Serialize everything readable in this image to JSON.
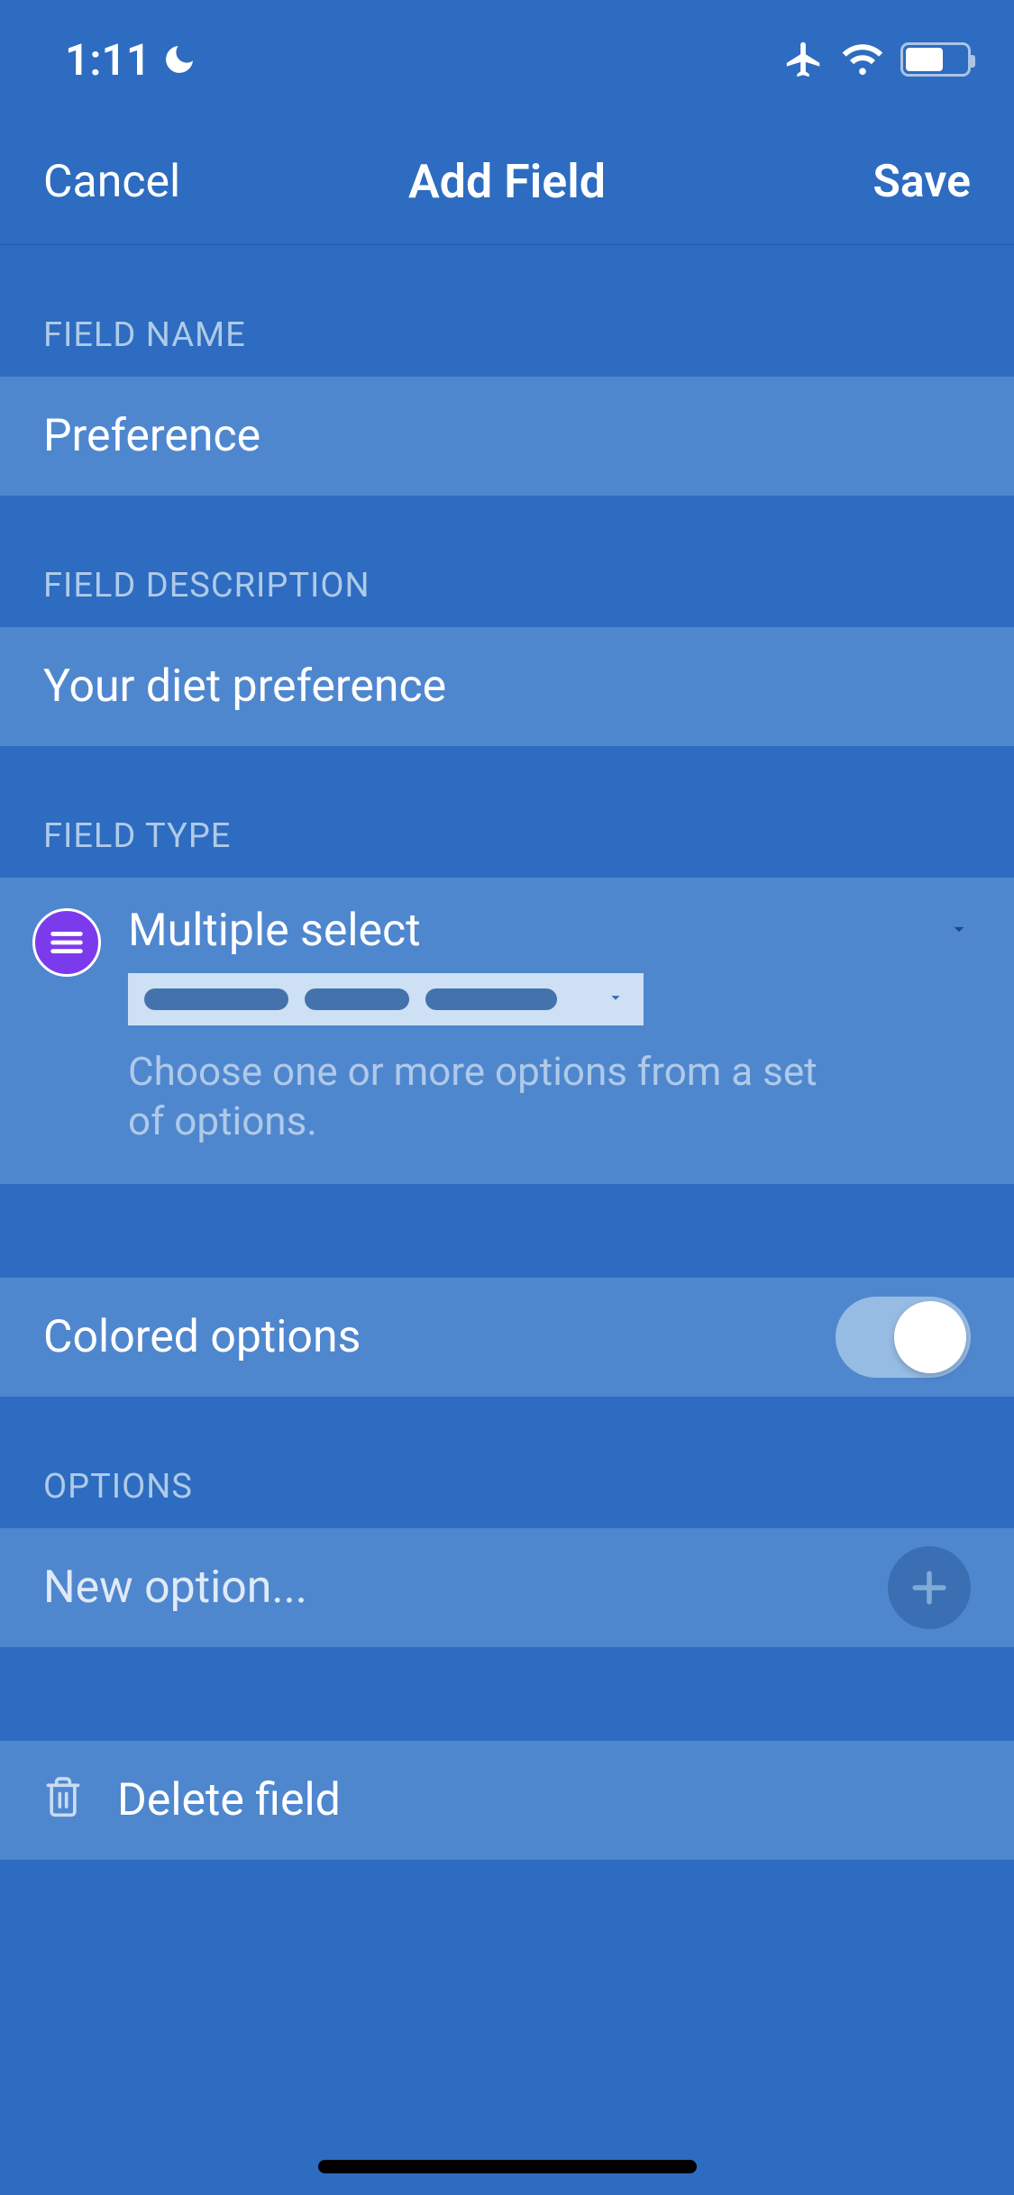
{
  "status": {
    "time": "1:11"
  },
  "nav": {
    "cancel": "Cancel",
    "title": "Add Field",
    "save": "Save"
  },
  "sections": {
    "field_name_header": "FIELD NAME",
    "field_description_header": "FIELD DESCRIPTION",
    "field_type_header": "FIELD TYPE",
    "options_header": "OPTIONS"
  },
  "fields": {
    "name_value": "Preference",
    "description_value": "Your diet preference"
  },
  "type": {
    "name": "Multiple select",
    "description": "Choose one or more options from a set of options."
  },
  "colored_options": {
    "label": "Colored options",
    "enabled": true
  },
  "new_option": {
    "placeholder": "New option..."
  },
  "delete": {
    "label": "Delete field"
  },
  "colors": {
    "bg": "#2d6cc0",
    "cell": "#4f87cf",
    "type_icon": "#7c3aed"
  }
}
